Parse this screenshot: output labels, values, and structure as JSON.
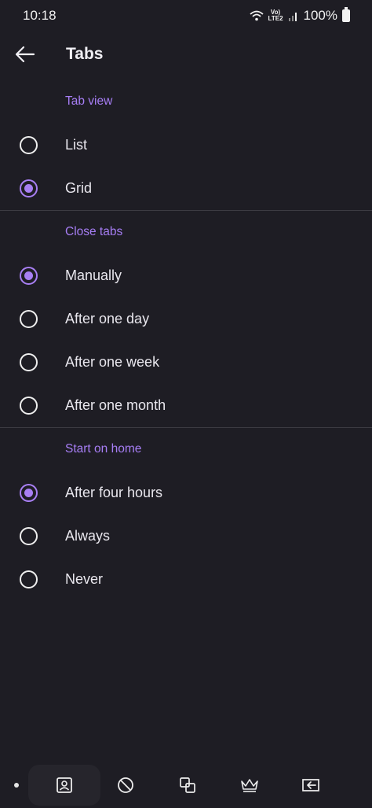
{
  "status_bar": {
    "time": "10:18",
    "network_top": "Vo)",
    "network_bottom": "LTE2",
    "battery": "100%"
  },
  "header": {
    "title": "Tabs",
    "back_icon": "arrow-left-icon"
  },
  "sections": {
    "tab_view": {
      "header": "Tab view",
      "options": [
        {
          "label": "List",
          "checked": false
        },
        {
          "label": "Grid",
          "checked": true
        }
      ]
    },
    "close_tabs": {
      "header": "Close tabs",
      "options": [
        {
          "label": "Manually",
          "checked": true
        },
        {
          "label": "After one day",
          "checked": false
        },
        {
          "label": "After one week",
          "checked": false
        },
        {
          "label": "After one month",
          "checked": false
        }
      ]
    },
    "start_on_home": {
      "header": "Start on home",
      "options": [
        {
          "label": "After four hours",
          "checked": true
        },
        {
          "label": "Always",
          "checked": false
        },
        {
          "label": "Never",
          "checked": false
        }
      ]
    }
  },
  "bottom_nav": {
    "items": [
      {
        "icon": "contact-card-icon",
        "active": true
      },
      {
        "icon": "block-icon",
        "active": false
      },
      {
        "icon": "copy-tabs-icon",
        "active": false
      },
      {
        "icon": "crown-icon",
        "active": false
      },
      {
        "icon": "exit-to-screen-icon",
        "active": false
      }
    ]
  },
  "colors": {
    "background": "#1e1d24",
    "accent": "#a87ff3",
    "divider": "#3c3b42"
  }
}
